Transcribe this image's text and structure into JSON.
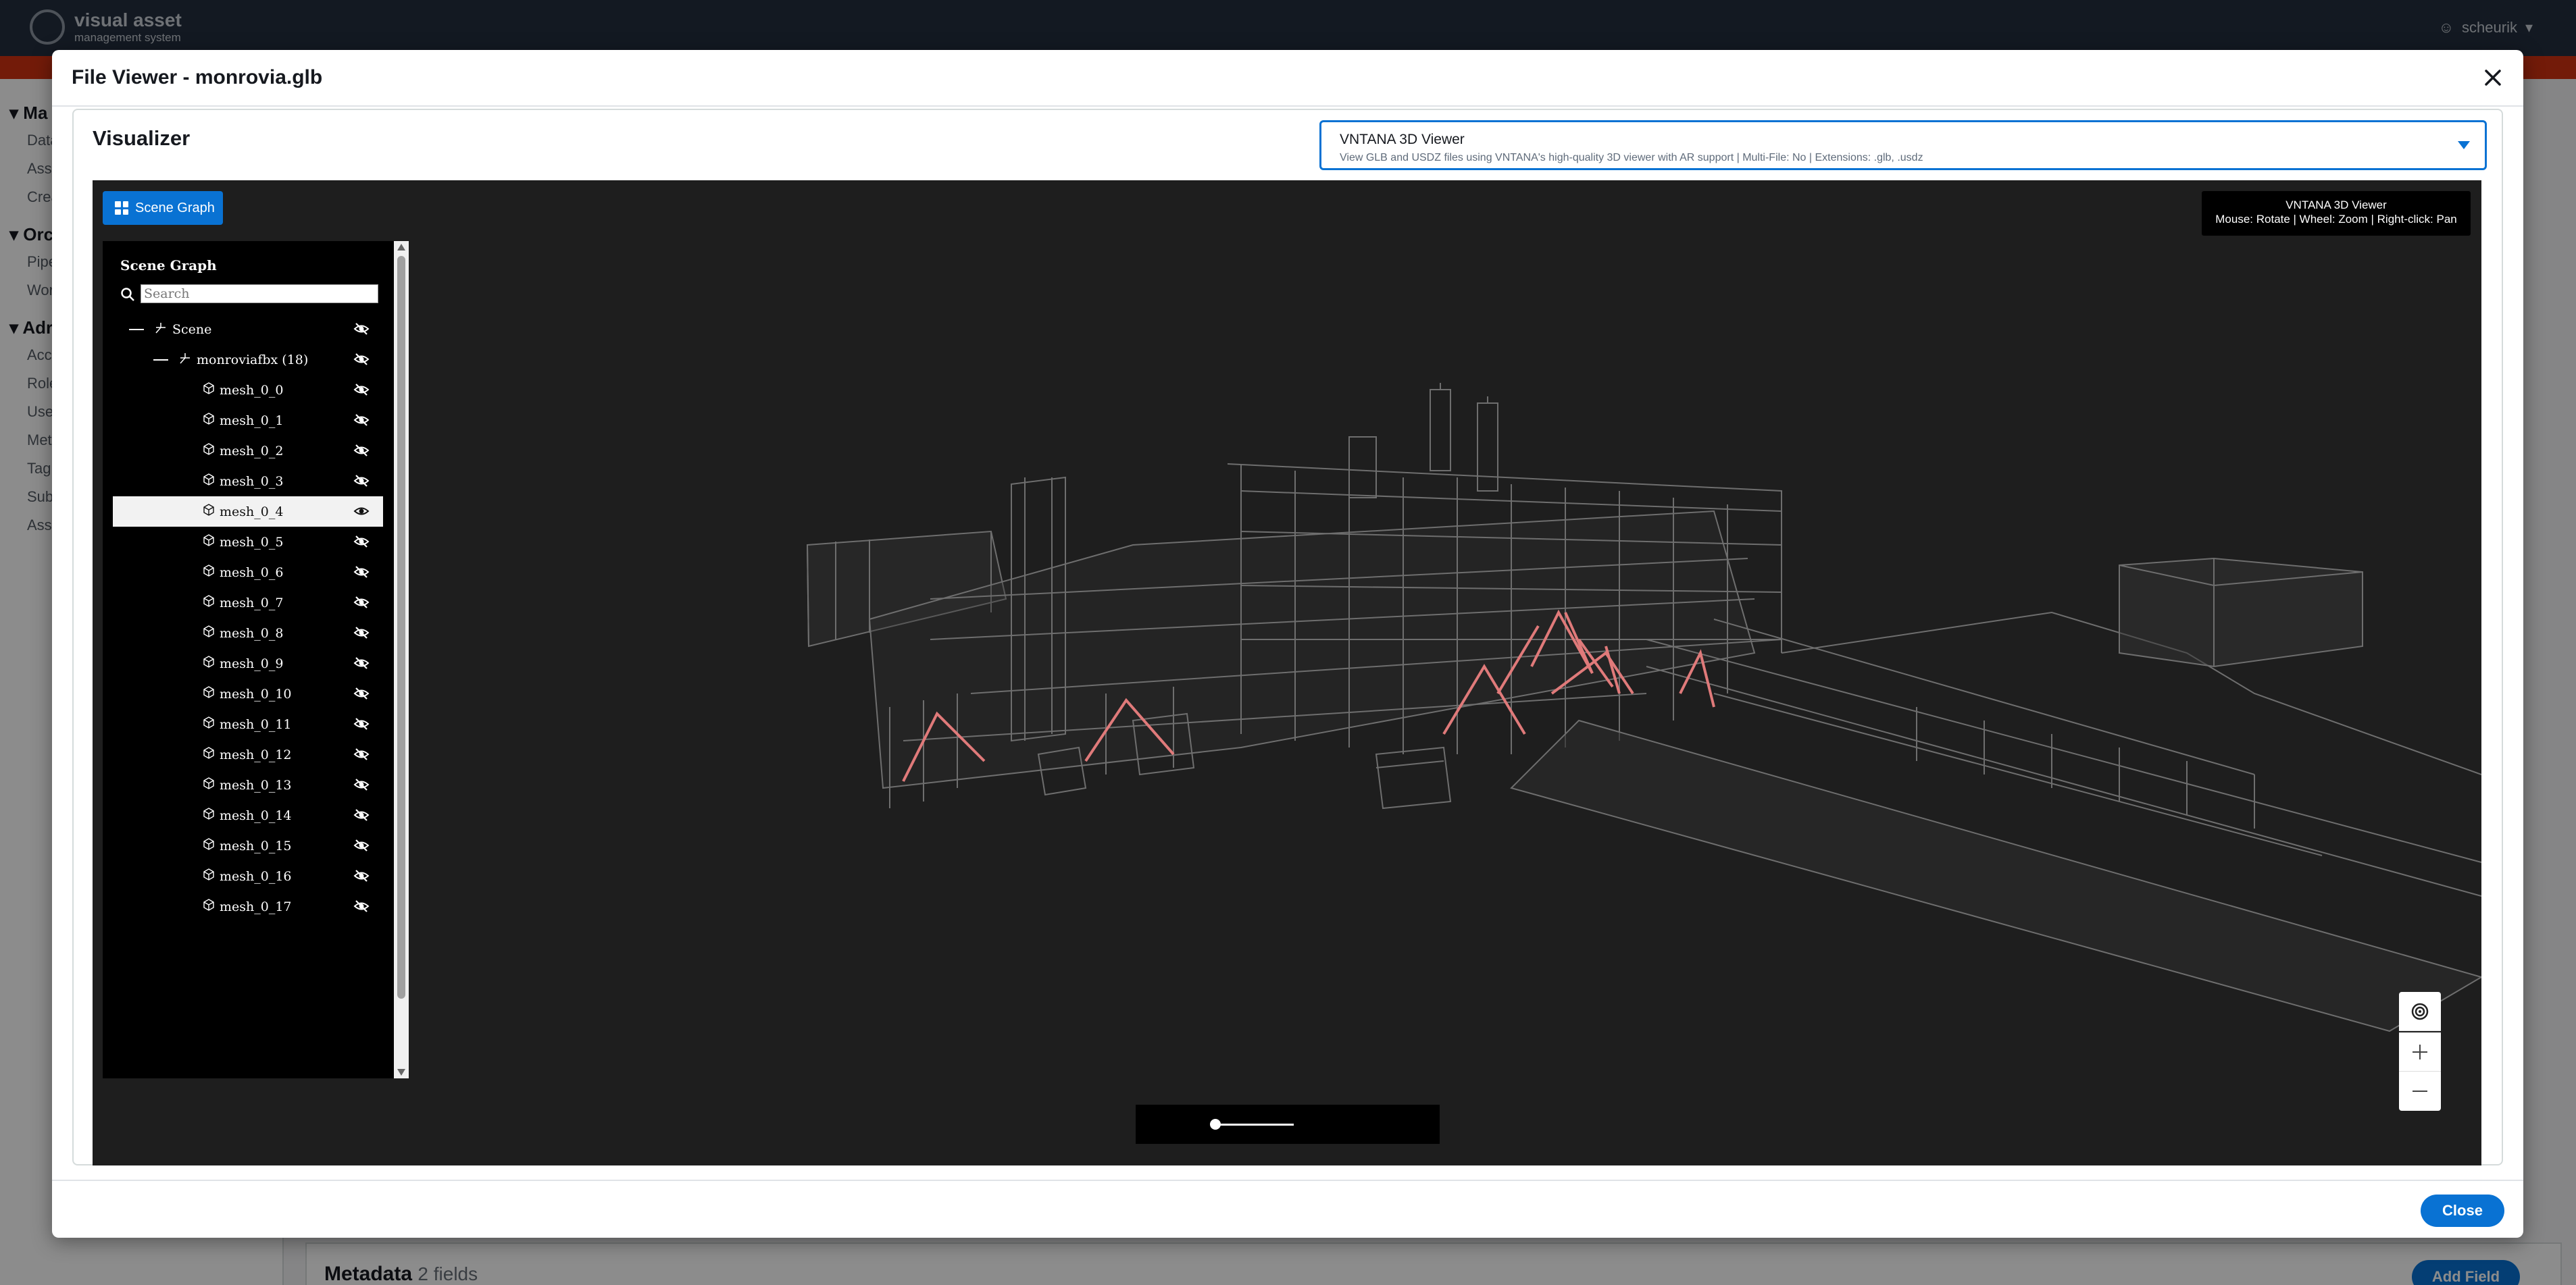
{
  "background": {
    "logo_title": "visual asset",
    "logo_subtitle": "management system",
    "user": "scheurik",
    "sidebar_groups": [
      "Ma",
      "Orc",
      "Adr"
    ],
    "sidebar_items_1": [
      "Data",
      "Ass",
      "Crea"
    ],
    "sidebar_items_2": [
      "Pipe",
      "Wor"
    ],
    "sidebar_items_3": [
      "Acc",
      "Role",
      "Use",
      "Met",
      "Tag",
      "Sub",
      "Ass"
    ],
    "metadata_title": "Metadata",
    "metadata_count": "2 fields",
    "add_field_label": "Add Field"
  },
  "modal": {
    "title": "File Viewer - monrovia.glb",
    "close_label": "Close"
  },
  "visualizer": {
    "title": "Visualizer",
    "viewer_name": "VNTANA 3D Viewer",
    "viewer_description": "View GLB and USDZ files using VNTANA's high-quality 3D viewer with AR support | Multi-File: No | Extensions: .glb, .usdz"
  },
  "canvas": {
    "scene_graph_button": "Scene Graph",
    "info_title": "VNTANA 3D Viewer",
    "info_help": "Mouse: Rotate | Wheel: Zoom | Right-click: Pan"
  },
  "scene_graph": {
    "title": "Scene Graph",
    "search_placeholder": "Search",
    "scene_label": "Scene",
    "group_label": "monroviafbx (18)",
    "selected_index": 4,
    "meshes": [
      "mesh_0_0",
      "mesh_0_1",
      "mesh_0_2",
      "mesh_0_3",
      "mesh_0_4",
      "mesh_0_5",
      "mesh_0_6",
      "mesh_0_7",
      "mesh_0_8",
      "mesh_0_9",
      "mesh_0_10",
      "mesh_0_11",
      "mesh_0_12",
      "mesh_0_13",
      "mesh_0_14",
      "mesh_0_15",
      "mesh_0_16",
      "mesh_0_17"
    ]
  },
  "colors": {
    "accent": "#0972d3",
    "canvas_bg": "#1e1e1e",
    "highlight_mesh": "#e07a7a"
  }
}
